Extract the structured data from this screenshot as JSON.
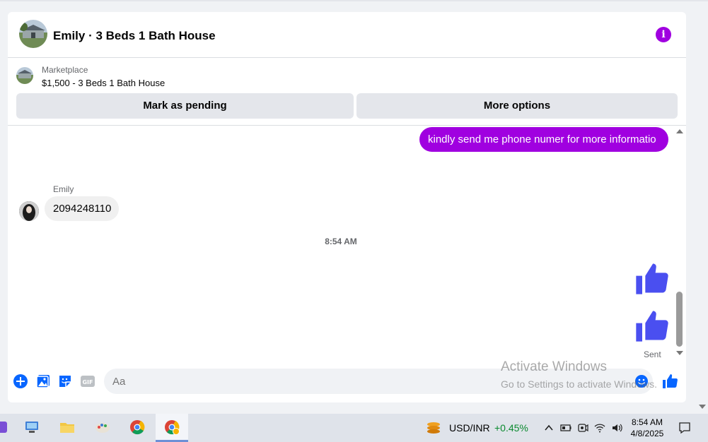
{
  "header": {
    "title": "Emily · 3 Beds 1 Bath House",
    "info_glyph": "i"
  },
  "listing": {
    "source": "Marketplace",
    "price_title": "$1,500 - 3 Beds 1 Bath House",
    "mark_pending_label": "Mark as pending",
    "more_options_label": "More options"
  },
  "messages": {
    "outgoing_text": "kindly send me phone numer for more informatio",
    "sender_name": "Emily",
    "incoming_text": "2094248110",
    "timestamp": "8:54 AM",
    "status": "Sent"
  },
  "composer": {
    "placeholder": "Aa"
  },
  "watermark": {
    "title": "Activate Windows",
    "subtitle": "Go to Settings to activate Windows."
  },
  "taskbar": {
    "currency_pair": "USD/INR",
    "currency_change": "+0.45%",
    "time": "8:54 AM",
    "date": "4/8/2025"
  },
  "colors": {
    "accent": "#a000e0",
    "like": "#4a4ff0",
    "bubble_in": "#f0f0f0"
  },
  "icons": [
    "info-icon",
    "plus-icon",
    "photo-icon",
    "sticker-icon",
    "gif-icon",
    "emoji-icon",
    "thumbs-up-icon",
    "chevron-up-icon",
    "chevron-down-icon"
  ]
}
